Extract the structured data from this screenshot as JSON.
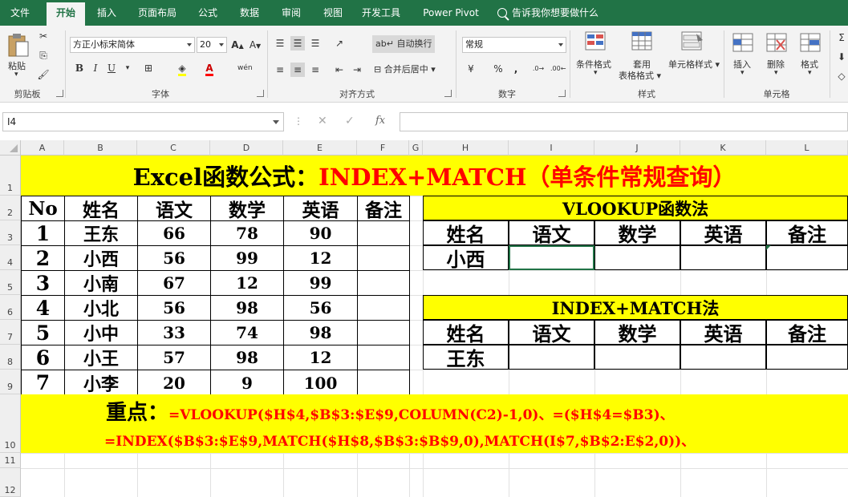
{
  "ribbon_tabs": [
    "文件",
    "开始",
    "插入",
    "页面布局",
    "公式",
    "数据",
    "审阅",
    "视图",
    "开发工具",
    "Power Pivot"
  ],
  "active_tab": "开始",
  "tell_me": "告诉我你想要做什么",
  "clipboard": {
    "paste": "粘贴",
    "group": "剪贴板"
  },
  "font": {
    "name": "方正小标宋简体",
    "size": "20",
    "group": "字体",
    "bold": "B",
    "italic": "I",
    "underline": "U"
  },
  "alignment": {
    "wrap": "自动换行",
    "merge": "合并后居中",
    "group": "对齐方式"
  },
  "number": {
    "format": "常规",
    "group": "数字",
    "percent": "%",
    "comma": ","
  },
  "styles": {
    "conditional": "条件格式",
    "table1": "套用",
    "table2": "表格格式",
    "cell_styles": "单元格样式",
    "group": "样式"
  },
  "cells": {
    "insert": "插入",
    "delete": "删除",
    "format": "格式",
    "group": "单元格"
  },
  "namebox": "I4",
  "fx": "fx",
  "columns": [
    "A",
    "B",
    "C",
    "D",
    "E",
    "F",
    "G",
    "H",
    "I",
    "J",
    "K",
    "L"
  ],
  "rows": [
    "1",
    "2",
    "3",
    "4",
    "5",
    "6",
    "7",
    "8",
    "9",
    "10",
    "11",
    "12"
  ],
  "sheet": {
    "title_black": "Excel函数公式：",
    "title_red": "INDEX+MATCH（单条件常规查询）",
    "headers": [
      "No",
      "姓名",
      "语文",
      "数学",
      "英语",
      "备注"
    ],
    "data": [
      [
        "1",
        "王东",
        "66",
        "78",
        "90",
        ""
      ],
      [
        "2",
        "小西",
        "56",
        "99",
        "12",
        ""
      ],
      [
        "3",
        "小南",
        "67",
        "12",
        "99",
        ""
      ],
      [
        "4",
        "小北",
        "56",
        "98",
        "56",
        ""
      ],
      [
        "5",
        "小中",
        "33",
        "74",
        "98",
        ""
      ],
      [
        "6",
        "小王",
        "57",
        "98",
        "12",
        ""
      ],
      [
        "7",
        "小李",
        "20",
        "9",
        "100",
        ""
      ]
    ],
    "vlookup_title": "VLOOKUP函数法",
    "vlookup_headers": [
      "姓名",
      "语文",
      "数学",
      "英语",
      "备注"
    ],
    "vlookup_name": "小西",
    "index_title": "INDEX+MATCH法",
    "index_headers": [
      "姓名",
      "语文",
      "数学",
      "英语",
      "备注"
    ],
    "index_name": "王东",
    "note_label": "重点：",
    "note_line1": "=VLOOKUP($H$4,$B$3:$E$9,COLUMN(C2)-1,0)、=($H$4=$B3)、",
    "note_line2": "=INDEX($B$3:$E$9,MATCH($H$8,$B$3:$B$9,0),MATCH(I$7,$B$2:E$2,0))、"
  }
}
